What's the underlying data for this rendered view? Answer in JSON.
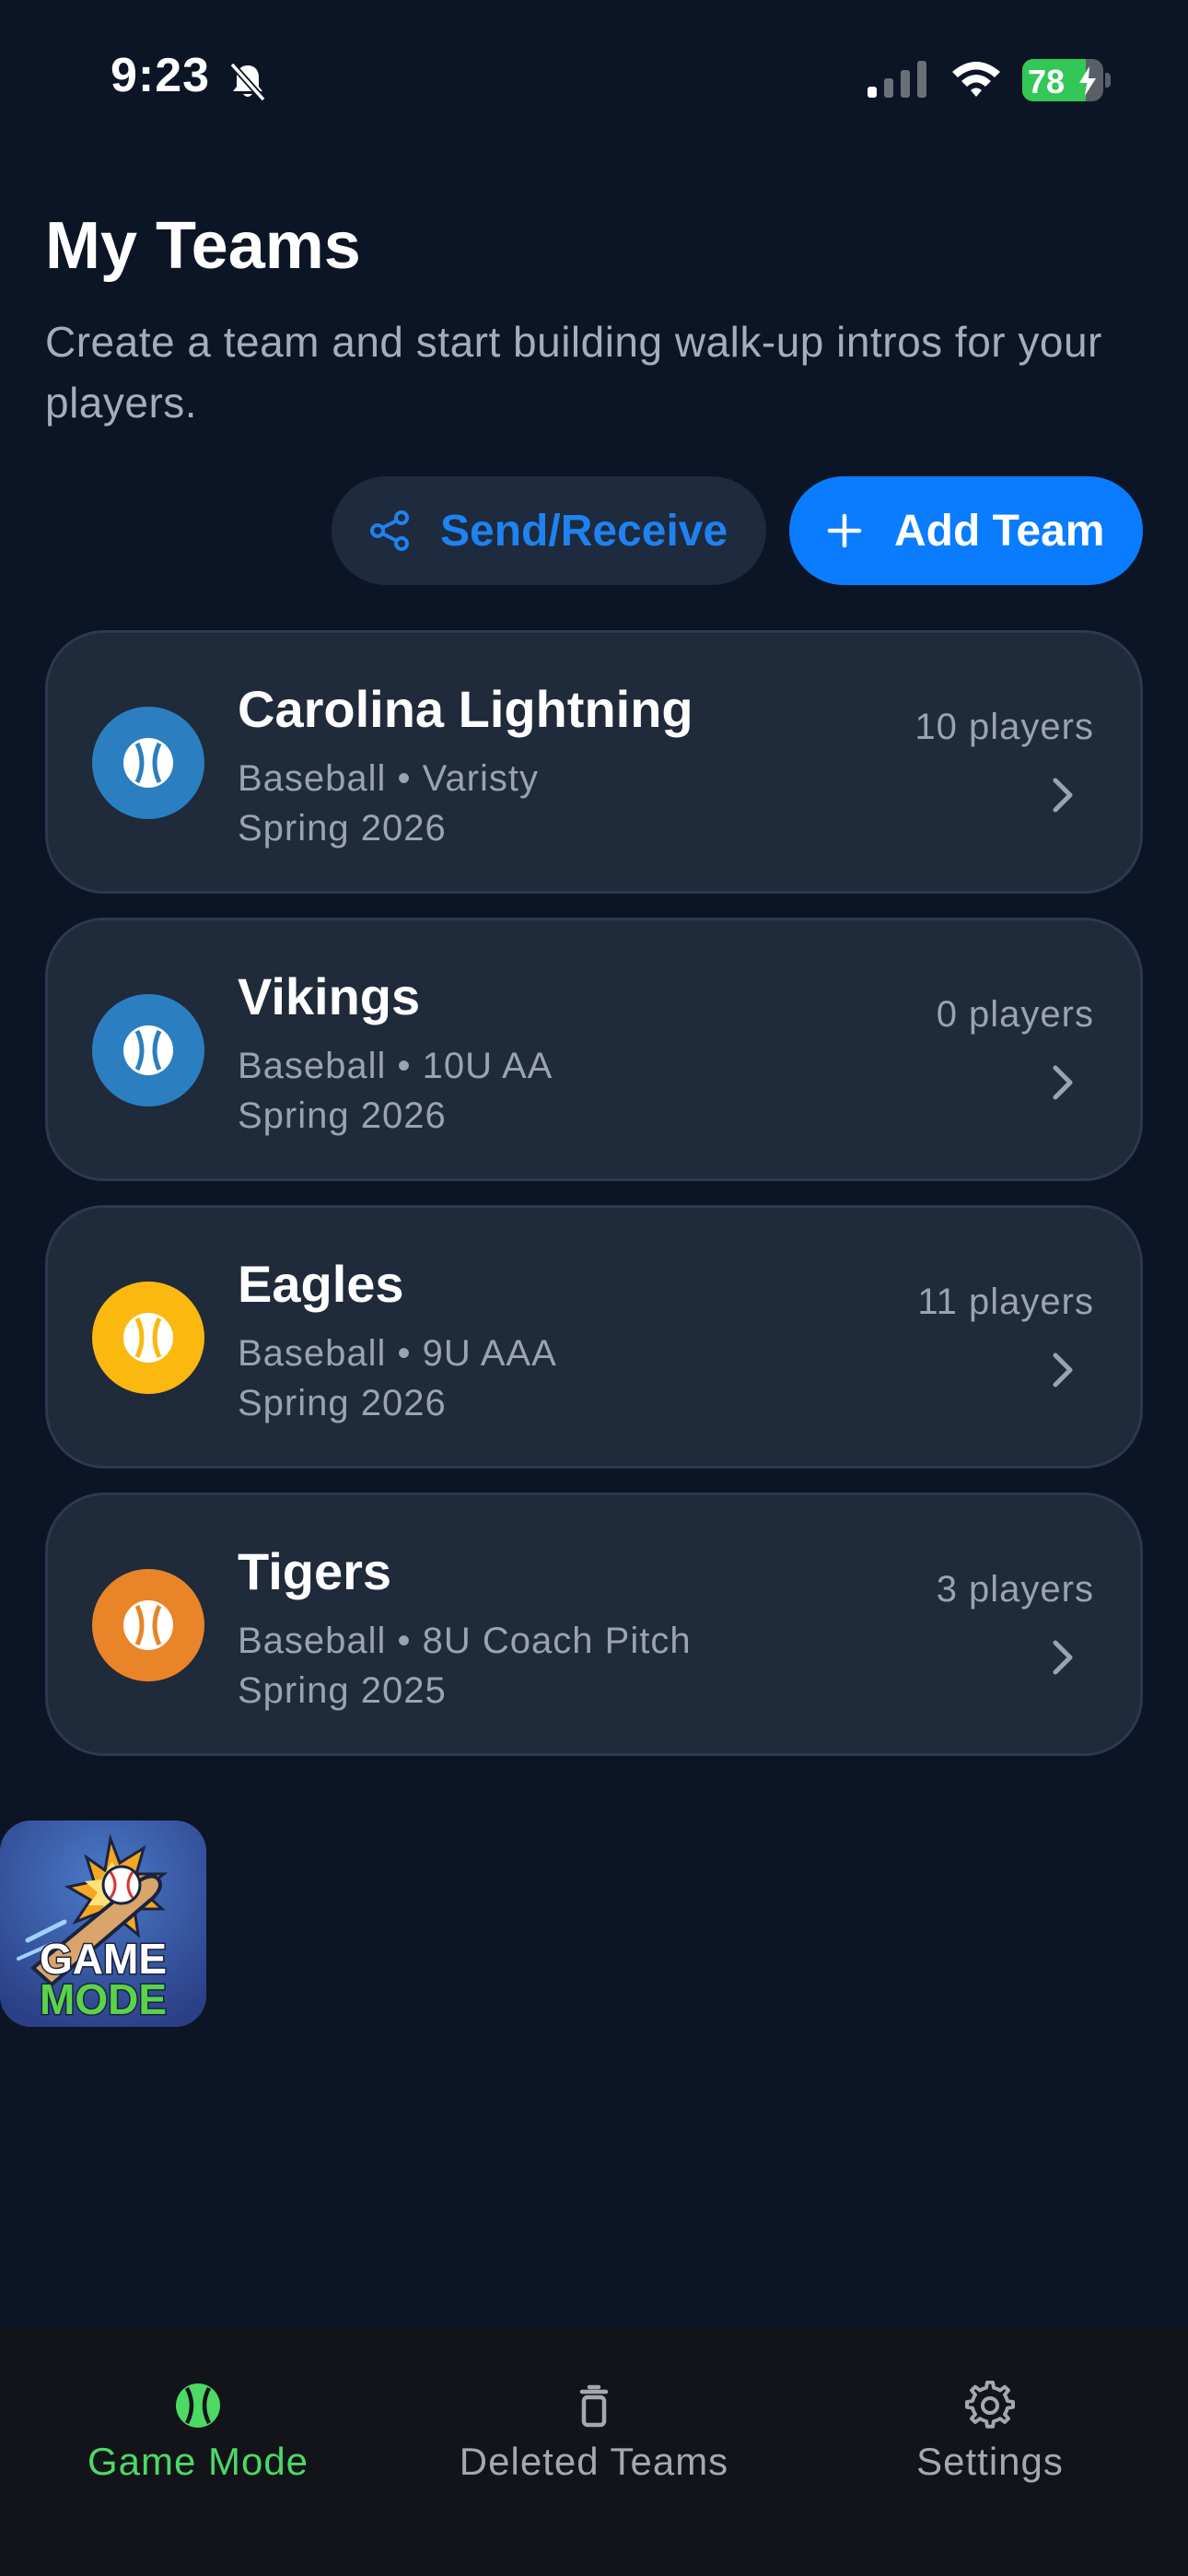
{
  "status_bar": {
    "time": "9:23",
    "battery_level": "78",
    "battery_fraction": 0.78,
    "icons": [
      "bell-slash-icon",
      "cellular-signal-icon",
      "wifi-icon",
      "battery-charging-icon"
    ]
  },
  "header": {
    "title": "My Teams",
    "subtitle": "Create a team and start building walk-up intros for your players."
  },
  "actions": {
    "send_receive_label": "Send/Receive",
    "add_team_label": "Add Team"
  },
  "teams": [
    {
      "name": "Carolina Lightning",
      "meta": "Baseball • Varisty",
      "season": "Spring 2026",
      "count": "10 players",
      "color": "#2b7fc0"
    },
    {
      "name": "Vikings",
      "meta": "Baseball • 10U AA",
      "season": "Spring 2026",
      "count": "0 players",
      "color": "#2b7fc0"
    },
    {
      "name": "Eagles",
      "meta": "Baseball • 9U AAA",
      "season": "Spring 2026",
      "count": "11 players",
      "color": "#fbb80f"
    },
    {
      "name": "Tigers",
      "meta": "Baseball • 8U Coach Pitch",
      "season": "Spring 2025",
      "count": "3 players",
      "color": "#e98428"
    }
  ],
  "game_mode_tile": {
    "line1": "GAME",
    "line2": "MODE"
  },
  "tabs": [
    {
      "label": "Game Mode",
      "icon": "baseball-icon",
      "active": true
    },
    {
      "label": "Deleted Teams",
      "icon": "trash-icon",
      "active": false
    },
    {
      "label": "Settings",
      "icon": "gear-icon",
      "active": false
    }
  ],
  "colors": {
    "background": "#0c1526",
    "card": "#1f2a3b",
    "accent_blue": "#0a7cff",
    "active_tab": "#4cd964",
    "inactive_tab": "#a4a8b0"
  }
}
